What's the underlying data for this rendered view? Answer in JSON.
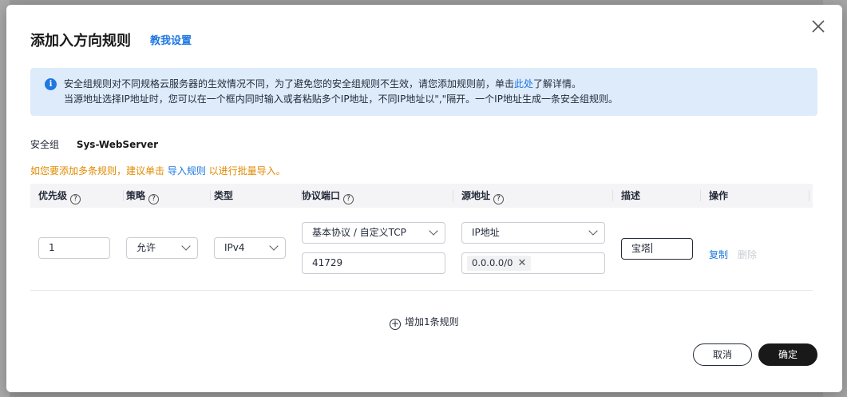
{
  "dialog": {
    "title": "添加入方向规则",
    "teach_link": "教我设置"
  },
  "notice": {
    "line1_prefix": "安全组规则对不同规格云服务器的生效情况不同，为了避免您的安全组规则不生效，请您添加规则前，单击",
    "line1_link": "此处",
    "line1_suffix": "了解详情。",
    "line2": "当源地址选择IP地址时，您可以在一个框内同时输入或者粘贴多个IP地址，不同IP地址以\",\"隔开。一个IP地址生成一条安全组规则。"
  },
  "security_group": {
    "label": "安全组",
    "value": "Sys-WebServer"
  },
  "hint": {
    "prefix": "如您要添加多条规则，建议单击 ",
    "link": "导入规则",
    "suffix": " 以进行批量导入。"
  },
  "table": {
    "headers": {
      "priority": "优先级",
      "policy": "策略",
      "type": "类型",
      "protocol_port": "协议端口",
      "source": "源地址",
      "description": "描述",
      "actions": "操作"
    },
    "row": {
      "priority": "1",
      "policy": "允许",
      "type": "IPv4",
      "protocol": "基本协议 / 自定义TCP",
      "port": "41729",
      "source_type": "IP地址",
      "source_ip": "0.0.0.0/0",
      "description": "宝塔",
      "copy": "复制",
      "delete": "删除"
    }
  },
  "add_rule": "增加1条规则",
  "buttons": {
    "cancel": "取消",
    "ok": "确定"
  },
  "colors": {
    "link": "#1e78e0",
    "hint": "#e08a00",
    "notice_bg": "#ddebfb",
    "primary_btn": "#191919"
  }
}
